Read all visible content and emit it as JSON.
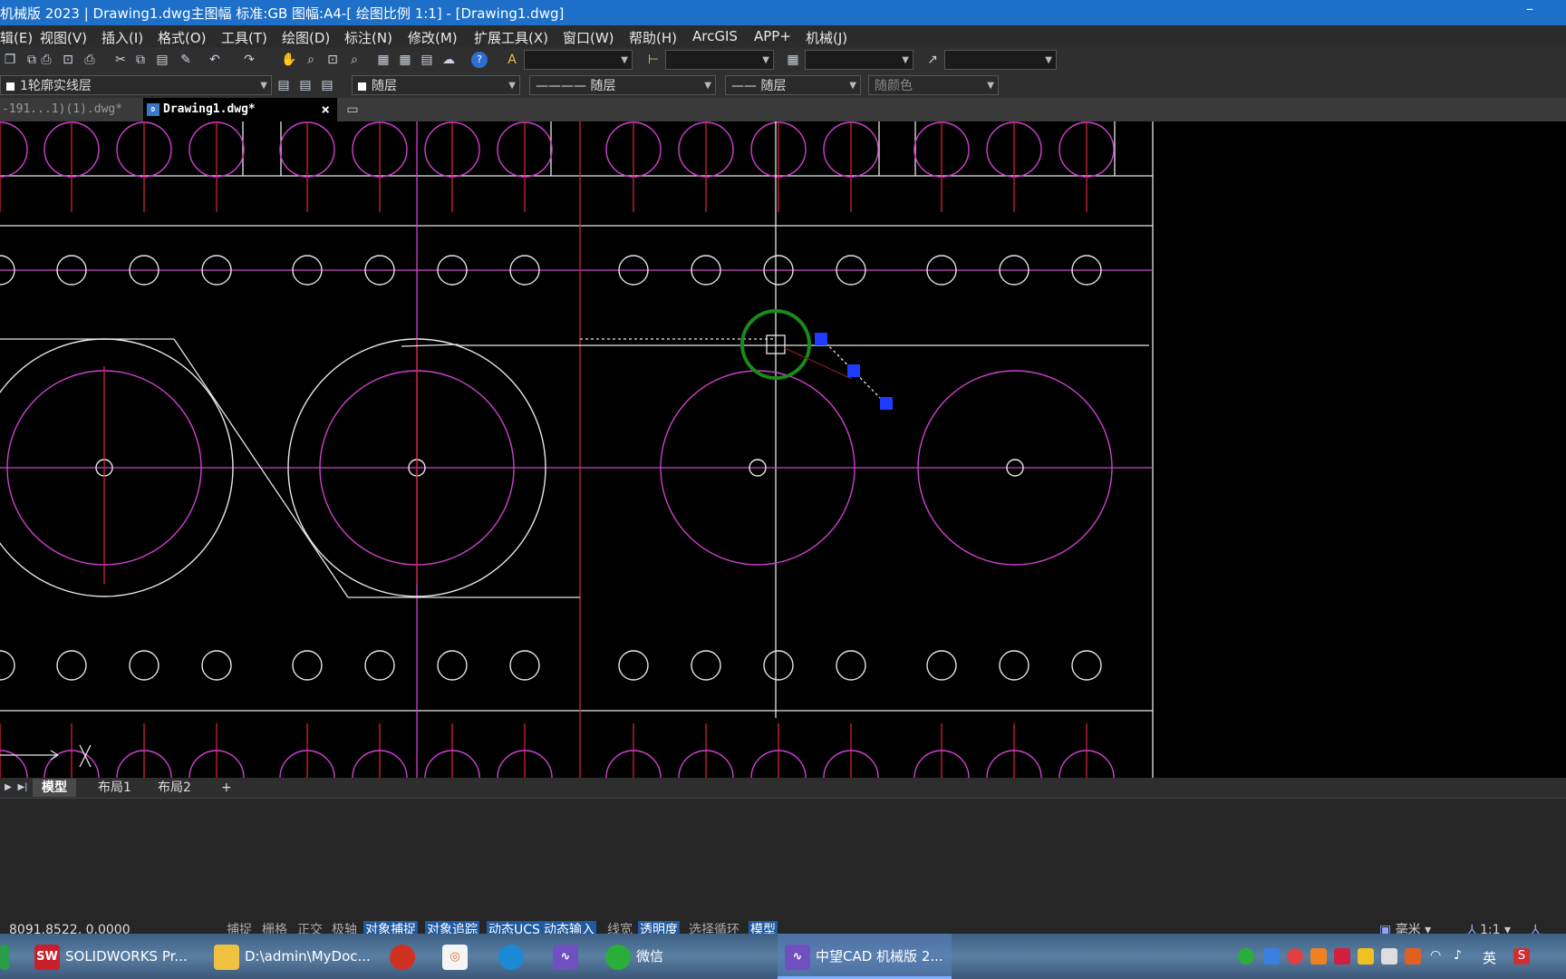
{
  "window": {
    "title": "机械版 2023 | Drawing1.dwg主图幅 标准:GB 图幅:A4-[ 绘图比例 1:1] - [Drawing1.dwg]",
    "minimize": "–"
  },
  "menubar": {
    "items": [
      "辑(E)",
      "视图(V)",
      "插入(I)",
      "格式(O)",
      "工具(T)",
      "绘图(D)",
      "标注(N)",
      "修改(M)",
      "扩展工具(X)",
      "窗口(W)",
      "帮助(H)",
      "ArcGIS",
      "APP+",
      "机械(J)"
    ]
  },
  "toolbar2": {
    "layer": "1轮廓实线层",
    "color": "随层",
    "linetype": "———— 随层",
    "lineweight": "—— 随层",
    "plotstyle": "随颜色"
  },
  "filetabs": {
    "tab1": "-191...1)(1).dwg*",
    "tab2": "Drawing1.dwg*",
    "close": "×"
  },
  "layouttabs": {
    "model": "模型",
    "layout1": "布局1",
    "layout2": "布局2",
    "add": "+"
  },
  "statusbar": {
    "coords": "8091.8522, 0.0000",
    "toggles": [
      "捕捉",
      "栅格",
      "正交",
      "极轴",
      "对象捕捉",
      "对象追踪",
      "动态UCS",
      "动态输入",
      "线宽",
      "透明度",
      "选择循环",
      "模型"
    ],
    "units": "毫米",
    "scale": "1:1"
  },
  "taskbar": {
    "solidworks": "SOLIDWORKS Pr...",
    "explorer": "D:\\admin\\MyDoc...",
    "wechat": "微信",
    "zwcad": "中望CAD 机械版 2...",
    "lang": "英"
  },
  "colors": {
    "magenta": "#d040d0",
    "red_center": "#d2223c",
    "white_line": "#e6e6e6",
    "grip": "#1e3cff",
    "snap": "#1a8a1a",
    "title": "#1e6fc8"
  }
}
